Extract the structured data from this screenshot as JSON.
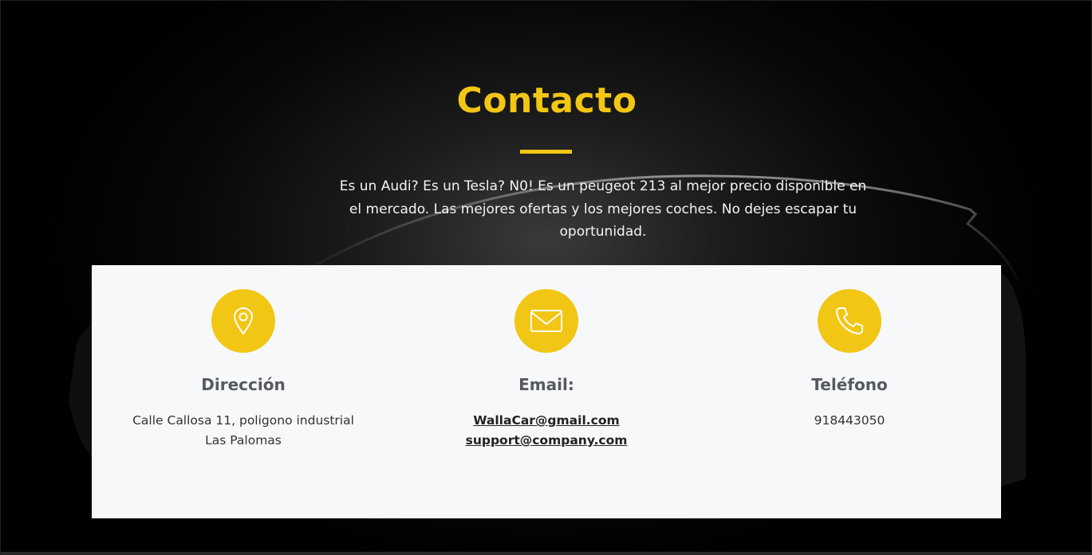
{
  "contact": {
    "title": "Contacto",
    "intro": "Es un Audi? Es un Tesla? N0! Es un peugeot 213 al mejor precio disponible en el mercado. Las mejores ofertas y los mejores coches. No dejes escapar tu oportunidad."
  },
  "columns": {
    "address": {
      "icon": "map-pin-icon",
      "heading": "Dirección",
      "text": "Calle Callosa 11, poligono industrial Las Palomas"
    },
    "email": {
      "icon": "envelope-icon",
      "heading": "Email:",
      "links": [
        "WallaCar@gmail.com",
        "support@company.com"
      ]
    },
    "phone": {
      "icon": "phone-icon",
      "heading": "Teléfono",
      "text": "918443050"
    }
  },
  "colors": {
    "accent": "#f2c614",
    "card_bg": "#f7f8fa",
    "background": "#000000"
  }
}
